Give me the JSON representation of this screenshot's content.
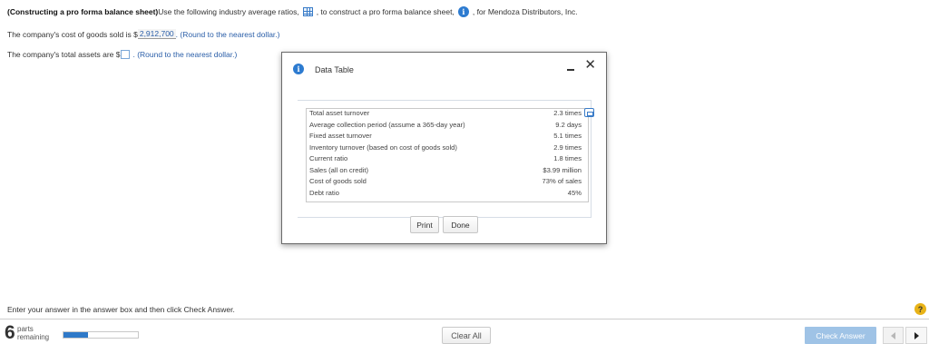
{
  "question": {
    "title_bold": "(Constructing a pro forma balance sheet)",
    "intro_text": " Use the following industry average ratios,",
    "middle_text": ", to construct a pro forma balance sheet,",
    "end_text": ", for Mendoza Distributors, Inc.",
    "cogs_prefix": "The company's cost of goods sold is $",
    "cogs_value": "2,912,700",
    "cogs_hint": ". (Round to the nearest dollar.)",
    "assets_prefix": "The company's total assets are $",
    "assets_value": "",
    "assets_hint": ". (Round to the nearest dollar.)"
  },
  "dialog": {
    "title": "Data Table",
    "rows": [
      {
        "label": "Total asset turnover",
        "value": "2.3 times"
      },
      {
        "label": "Average collection period (assume a 365-day year)",
        "value": "9.2 days"
      },
      {
        "label": "Fixed asset turnover",
        "value": "5.1 times"
      },
      {
        "label": "Inventory turnover (based on cost of goods sold)",
        "value": "2.9 times"
      },
      {
        "label": "Current ratio",
        "value": "1.8 times"
      },
      {
        "label": "Sales (all on credit)",
        "value": "$3.99 million"
      },
      {
        "label": "Cost of goods sold",
        "value": "73% of sales"
      },
      {
        "label": "Debt ratio",
        "value": "45%"
      }
    ],
    "print_label": "Print",
    "done_label": "Done"
  },
  "footer": {
    "hint": "Enter your answer in the answer box and then click Check Answer.",
    "help_label": "?",
    "parts_count": "6",
    "parts_label_1": "parts",
    "parts_label_2": "remaining",
    "progress_fraction": 0.33,
    "clear_all_label": "Clear All",
    "check_answer_label": "Check Answer"
  },
  "colors": {
    "accent": "#2f79c8",
    "check_button": "#9fc3e6",
    "help": "#e8b318"
  }
}
